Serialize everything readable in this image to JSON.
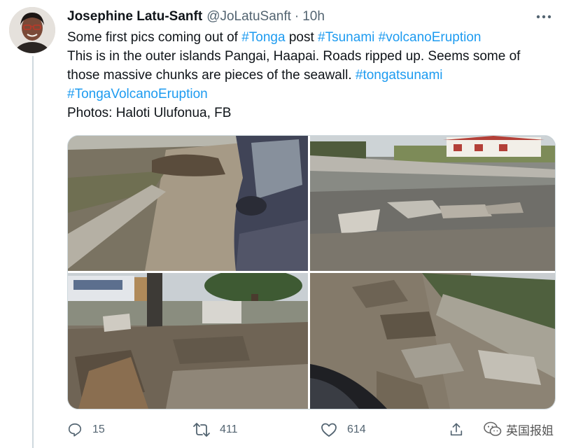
{
  "author": {
    "display_name": "Josephine Latu-Sanft",
    "handle": "@JoLatuSanft",
    "separator": "·",
    "time": "10h"
  },
  "tweet": {
    "line1": {
      "t1": "Some first pics coming out of ",
      "h1": "#Tonga",
      "t2": " post ",
      "h2": "#Tsunami",
      "t3": " ",
      "h3": "#volcanoEruption"
    },
    "line2": "This is in the outer islands Pangai, Haapai. Roads ripped up. Seems some of",
    "line3": {
      "t1": "those massive chunks are pieces of the seawall. ",
      "h1": "#tongatsunami"
    },
    "line4": {
      "h1": "#TongaVolcanoEruption"
    },
    "line5": "Photos: Haloti Ulufonua, FB"
  },
  "metrics": {
    "replies": "15",
    "retweets": "411",
    "likes": "614"
  },
  "watermark": "英国报姐",
  "icons": {
    "more": "more-horizontal-icon",
    "reply": "reply-icon",
    "retweet": "retweet-icon",
    "like": "heart-icon",
    "share": "share-icon"
  },
  "colors": {
    "link": "#1d9bf0",
    "muted": "#536471",
    "text": "#0f1419"
  }
}
